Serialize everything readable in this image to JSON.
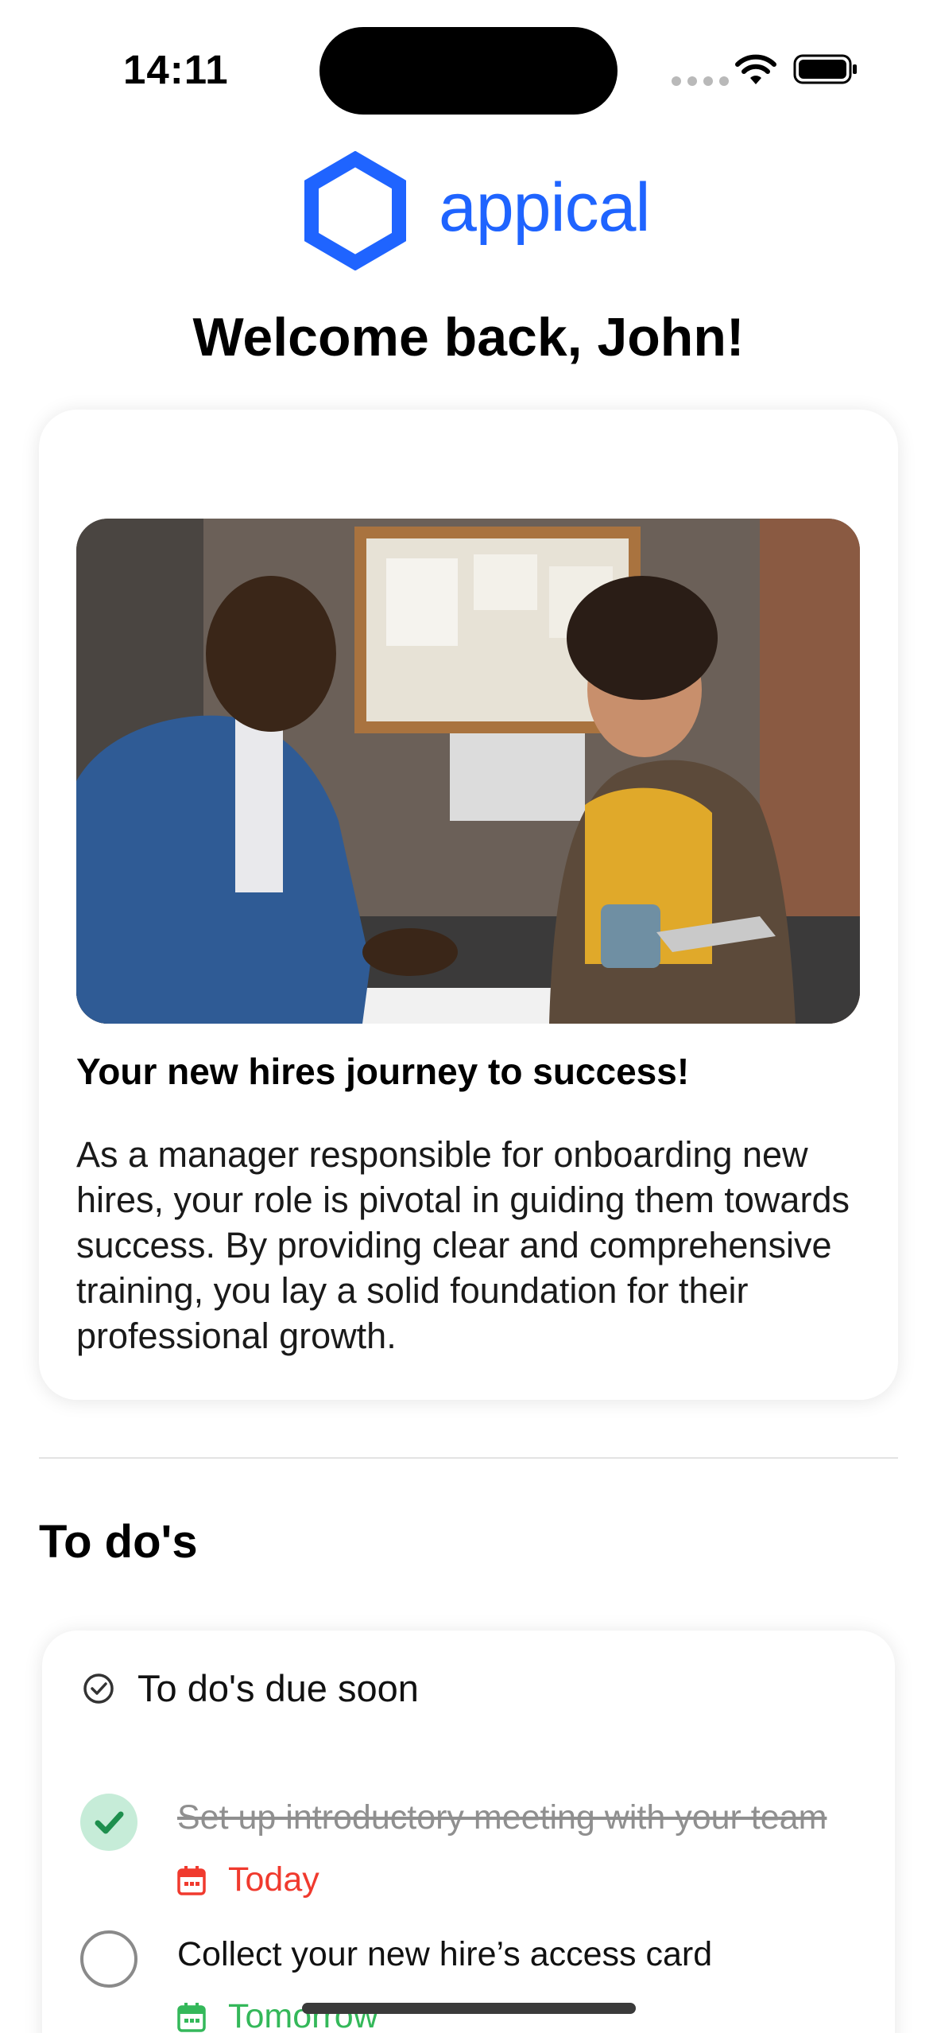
{
  "status_bar": {
    "time": "14:11"
  },
  "brand": {
    "name": "appical",
    "color": "#1f64ff"
  },
  "welcome": "Welcome back, John!",
  "intro": {
    "image_alt": "Two colleagues reviewing documents at a desk",
    "heading": "Your new hires journey to success!",
    "body": "As a manager responsible for onboarding new hires, your role is pivotal in guiding them towards success. By providing clear and comprehensive training, you lay a solid foundation for their professional growth."
  },
  "todos": {
    "section_title": "To do's",
    "card_title": "To do's due soon",
    "items": [
      {
        "text": "Set up introductory meeting with your team",
        "completed": true,
        "due": "Today",
        "due_color": "#f03a2e"
      },
      {
        "text": "Collect your new hire’s access card",
        "completed": false,
        "due": "Tomorrow",
        "due_color": "#34b85a"
      }
    ]
  },
  "colors": {
    "done_check_bg": "#c6ecd8",
    "done_check": "#1e8f4e"
  }
}
